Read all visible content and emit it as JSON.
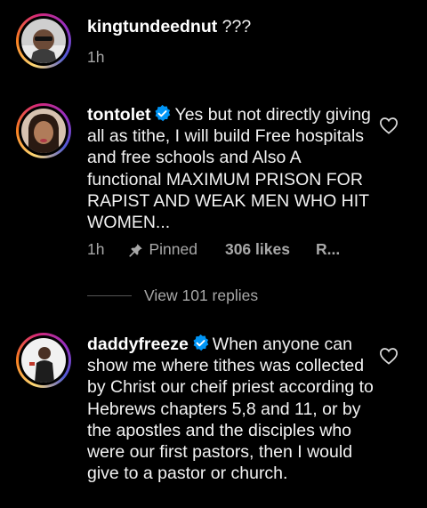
{
  "comments": [
    {
      "username": "kingtundeednut",
      "text": " ???",
      "verified": false,
      "time": "1h"
    },
    {
      "username": "tontolet",
      "text": "Yes but not directly giving all as tithe, I will build Free hospitals and free schools and Also A functional MAXIMUM PRISON FOR RAPIST AND WEAK MEN WHO HIT WOMEN...",
      "verified": true,
      "time": "1h",
      "pinned_label": "Pinned",
      "likes": "306 likes",
      "reply_label": "R...",
      "view_replies": "View 101 replies"
    },
    {
      "username": "daddyfreeze",
      "text": "When anyone can show me where tithes was collected by Christ our cheif priest according to Hebrews chapters 5,8 and 11, or by the apostles and the disciples who were our first pastors, then I would give to a pastor or church.",
      "verified": true
    }
  ],
  "colors": {
    "background": "#000000",
    "text": "#f5f5f5",
    "muted": "#a8a8a8",
    "verified_badge": "#0095f6"
  },
  "icons": [
    "heart-outline-icon",
    "pin-icon",
    "verified-badge-icon"
  ]
}
